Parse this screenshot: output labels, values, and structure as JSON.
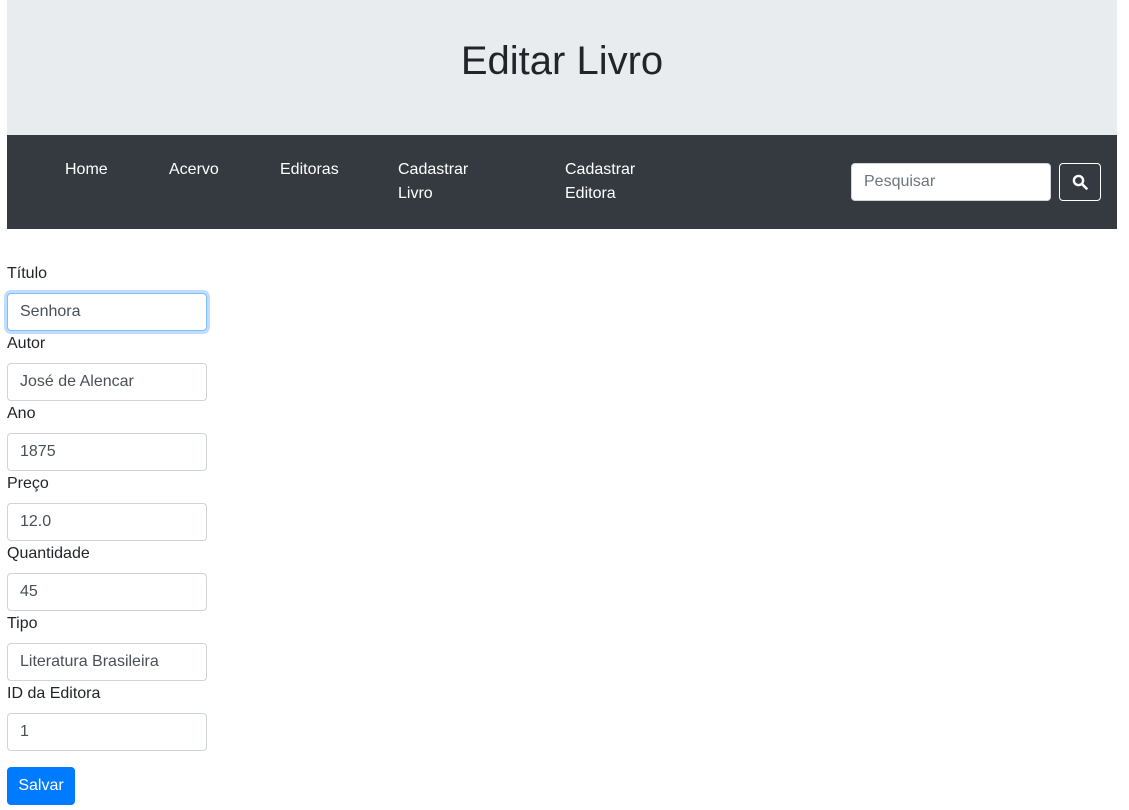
{
  "header": {
    "title": "Editar Livro"
  },
  "nav": {
    "items": [
      {
        "label": "Home"
      },
      {
        "label": "Acervo"
      },
      {
        "label": "Editoras"
      },
      {
        "label": "Cadastrar Livro"
      },
      {
        "label": "Cadastrar Editora"
      }
    ],
    "search": {
      "placeholder": "Pesquisar",
      "value": "",
      "button_icon": "search-icon"
    }
  },
  "form": {
    "fields": [
      {
        "label": "Título",
        "value": "Senhora",
        "focused": true
      },
      {
        "label": "Autor",
        "value": "José de Alencar"
      },
      {
        "label": "Ano",
        "value": "1875"
      },
      {
        "label": "Preço",
        "value": "12.0"
      },
      {
        "label": "Quantidade",
        "value": "45"
      },
      {
        "label": "Tipo",
        "value": "Literatura Brasileira"
      },
      {
        "label": "ID da Editora",
        "value": "1"
      }
    ],
    "submit_label": "Salvar"
  },
  "colors": {
    "jumbotron_bg": "#e9ecef",
    "navbar_bg": "#343a40",
    "primary": "#007bff"
  }
}
